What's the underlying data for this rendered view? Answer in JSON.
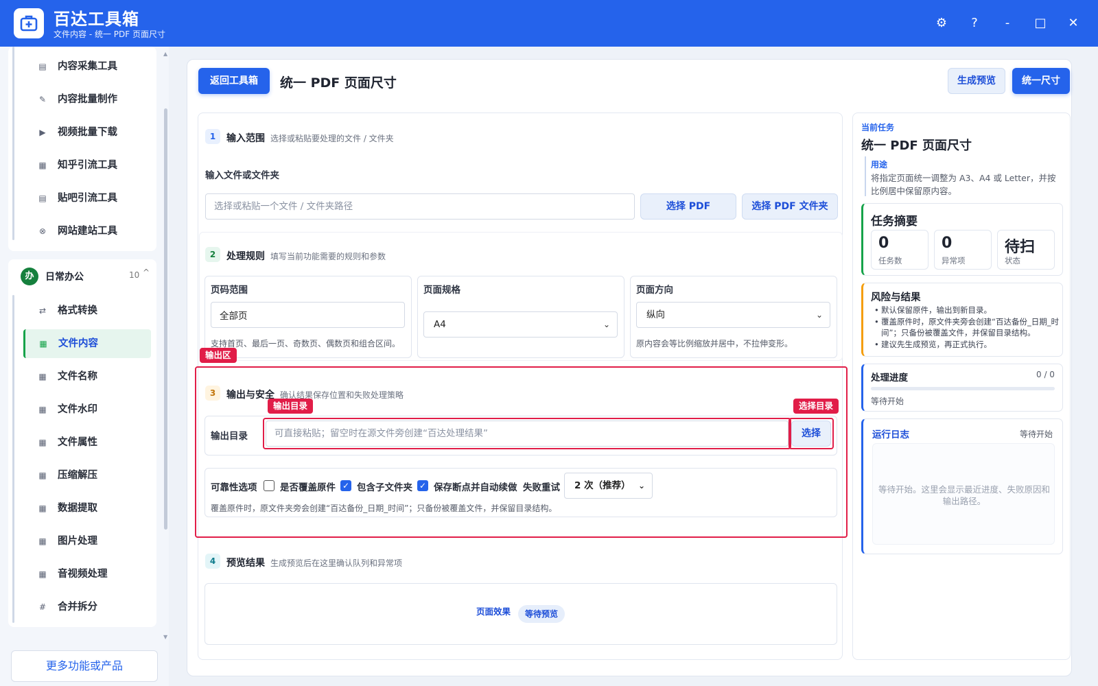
{
  "app": {
    "name": "百达工具箱",
    "subtitle": "文件内容 - 统一 PDF 页面尺寸"
  },
  "window": {
    "settings_icon": "⚙",
    "help": "?",
    "minimize": "-",
    "maximize": "□",
    "close": "✕"
  },
  "sidebar": {
    "top_items": [
      {
        "label": "内容采集工具",
        "icon": "▤"
      },
      {
        "label": "内容批量制作",
        "icon": "✎"
      },
      {
        "label": "视频批量下载",
        "icon": "▶"
      },
      {
        "label": "知乎引流工具",
        "icon": "▦"
      },
      {
        "label": "贴吧引流工具",
        "icon": "▤"
      },
      {
        "label": "网站建站工具",
        "icon": "⊗"
      }
    ],
    "group": {
      "badge": "办",
      "title": "日常办公",
      "count": "10",
      "caret": "^"
    },
    "items": [
      {
        "label": "格式转换",
        "icon": "⇄"
      },
      {
        "label": "文件内容",
        "icon": "▦"
      },
      {
        "label": "文件名称",
        "icon": "▦"
      },
      {
        "label": "文件水印",
        "icon": "▦"
      },
      {
        "label": "文件属性",
        "icon": "▦"
      },
      {
        "label": "压缩解压",
        "icon": "▦"
      },
      {
        "label": "数据提取",
        "icon": "▦"
      },
      {
        "label": "图片处理",
        "icon": "▦"
      },
      {
        "label": "音视频处理",
        "icon": "▦"
      },
      {
        "label": "合并拆分",
        "icon": "#"
      }
    ],
    "more_button": "更多功能或产品"
  },
  "toolbar": {
    "back": "返回工具箱",
    "title": "统一 PDF 页面尺寸",
    "preview": "生成预览",
    "run": "统一尺寸"
  },
  "step1": {
    "num": "1",
    "title": "输入范围",
    "hint": "选择或粘贴要处理的文件 / 文件夹",
    "field_label": "输入文件或文件夹",
    "placeholder": "选择或粘贴一个文件 / 文件夹路径",
    "btn_pdf": "选择 PDF",
    "btn_folder": "选择 PDF 文件夹"
  },
  "step2": {
    "num": "2",
    "title": "处理规则",
    "hint": "填写当前功能需要的规则和参数",
    "page_range": {
      "label": "页码范围",
      "value": "全部页",
      "note": "支持首页、最后一页、奇数页、偶数页和组合区间。"
    },
    "page_size": {
      "label": "页面规格",
      "value": "A4"
    },
    "orientation": {
      "label": "页面方向",
      "value": "纵向",
      "note": "原内容会等比例缩放并居中，不拉伸变形。"
    }
  },
  "step3": {
    "num": "3",
    "title": "输出与安全",
    "hint": "确认结果保存位置和失败处理策略",
    "out_label": "输出目录",
    "out_placeholder": "可直接粘贴；留空时在源文件旁创建“百达处理结果”",
    "choose": "选择",
    "reliability_label": "可靠性选项",
    "overwrite": "是否覆盖原件",
    "include_sub": "包含子文件夹",
    "resume": "保存断点并自动续做",
    "retry_label": "失败重试",
    "retry_value": "2 次（推荐）",
    "note": "覆盖原件时，原文件夹旁会创建“百达备份_日期_时间”；只备份被覆盖文件，并保留目录结构。"
  },
  "overlay": {
    "output_area": "输出区",
    "output_dir": "输出目录",
    "choose_dir": "选择目录"
  },
  "step4": {
    "num": "4",
    "title": "预览结果",
    "hint": "生成预览后在这里确认队列和异常项",
    "effect": "页面效果",
    "status": "等待预览"
  },
  "right": {
    "current_label": "当前任务",
    "task_title": "统一 PDF 页面尺寸",
    "purpose_label": "用途",
    "purpose_text": "将指定页面统一调整为 A3、A4 或 Letter，并按比例居中保留原内容。",
    "summary_title": "任务摘要",
    "stats": [
      {
        "value": "0",
        "label": "任务数"
      },
      {
        "value": "0",
        "label": "异常项"
      },
      {
        "value": "待扫",
        "label": "状态"
      }
    ],
    "risk_title": "风险与结果",
    "risks": [
      "默认保留原件，输出到新目录。",
      "覆盖原件时，原文件夹旁会创建“百达备份_日期_时间”；只备份被覆盖文件，并保留目录结构。",
      "建议先生成预览，再正式执行。"
    ],
    "progress_title": "处理进度",
    "progress_value": "0 / 0",
    "progress_status": "等待开始",
    "log_title": "运行日志",
    "log_status": "等待开始",
    "log_placeholder": "等待开始。这里会显示最近进度、失败原因和输出路径。"
  },
  "colors": {
    "brand": "#2563eb",
    "highlight": "#e11d48",
    "active_green": "#16a34a"
  }
}
